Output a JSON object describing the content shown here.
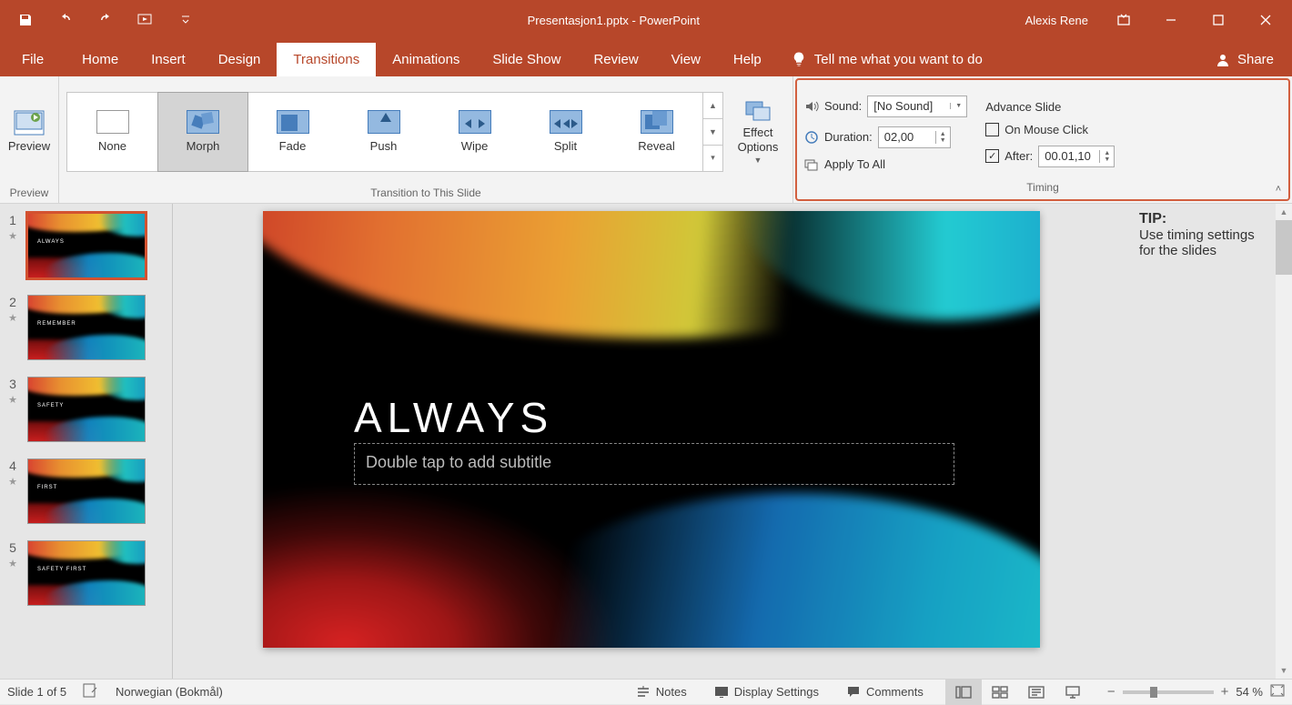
{
  "titlebar": {
    "title": "Presentasjon1.pptx  -  PowerPoint",
    "user": "Alexis Rene"
  },
  "tabs": {
    "file": "File",
    "home": "Home",
    "insert": "Insert",
    "design": "Design",
    "transitions": "Transitions",
    "animations": "Animations",
    "slideshow": "Slide Show",
    "review": "Review",
    "view": "View",
    "help": "Help",
    "tellme": "Tell me what you want to do",
    "share": "Share"
  },
  "ribbon": {
    "preview": "Preview",
    "preview_group": "Preview",
    "gallery_group": "Transition to This Slide",
    "gallery": {
      "none": "None",
      "morph": "Morph",
      "fade": "Fade",
      "push": "Push",
      "wipe": "Wipe",
      "split": "Split",
      "reveal": "Reveal"
    },
    "effect_options": "Effect Options",
    "timing": {
      "group_label": "Timing",
      "sound": "Sound:",
      "sound_value": "[No Sound]",
      "duration": "Duration:",
      "duration_value": "02,00",
      "apply_all": "Apply To All",
      "advance": "Advance Slide",
      "on_click": "On Mouse Click",
      "after": "After:",
      "after_value": "00.01,10"
    }
  },
  "thumbnails": [
    {
      "num": "1",
      "title": "ALWAYS"
    },
    {
      "num": "2",
      "title": "REMEMBER"
    },
    {
      "num": "3",
      "title": "SAFETY"
    },
    {
      "num": "4",
      "title": "FIRST"
    },
    {
      "num": "5",
      "title": "SAFETY FIRST"
    }
  ],
  "slide": {
    "title": "ALWAYS",
    "subtitle_placeholder": "Double tap to add subtitle"
  },
  "tip": {
    "heading": "TIP:",
    "body": "Use timing settings for the slides"
  },
  "statusbar": {
    "slide_info": "Slide 1 of 5",
    "language": "Norwegian (Bokmål)",
    "notes": "Notes",
    "display": "Display Settings",
    "comments": "Comments",
    "zoom": "54 %"
  }
}
